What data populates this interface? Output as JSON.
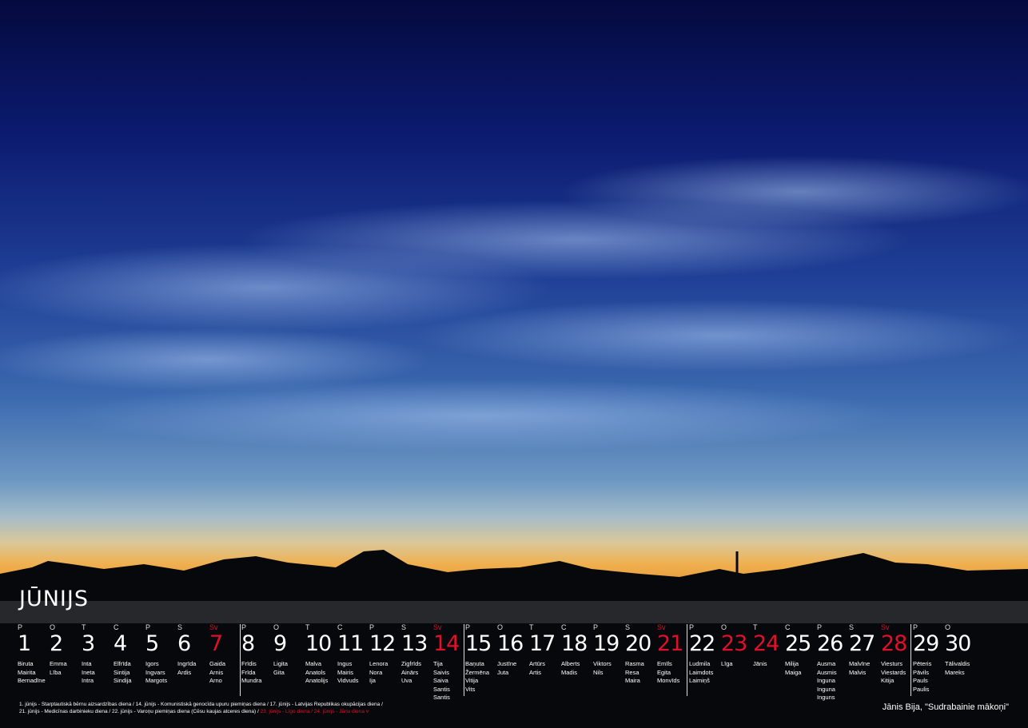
{
  "month": "JŪNIJS",
  "days": [
    {
      "wd": "P",
      "num": "1",
      "names": [
        "Biruta",
        "Mairita",
        "Bernadīne"
      ]
    },
    {
      "wd": "O",
      "num": "2",
      "names": [
        "Emma",
        "Lība"
      ]
    },
    {
      "wd": "T",
      "num": "3",
      "names": [
        "Inta",
        "Ineta",
        "Intra"
      ]
    },
    {
      "wd": "C",
      "num": "4",
      "names": [
        "Elfrīda",
        "Sintija",
        "Sindija"
      ]
    },
    {
      "wd": "P",
      "num": "5",
      "names": [
        "Igors",
        "Ingvars",
        "Margots"
      ]
    },
    {
      "wd": "S",
      "num": "6",
      "names": [
        "Ingrīda",
        "Ardis"
      ]
    },
    {
      "wd": "Sv",
      "num": "7",
      "names": [
        "Gaida",
        "Arnis",
        "Arno"
      ],
      "red": true
    },
    {
      "wd": "P",
      "num": "8",
      "names": [
        "Frīdis",
        "Frīda",
        "Mundra"
      ]
    },
    {
      "wd": "O",
      "num": "9",
      "names": [
        "Ligita",
        "Gita"
      ]
    },
    {
      "wd": "T",
      "num": "10",
      "names": [
        "Malva",
        "Anatols",
        "Anatolijs"
      ]
    },
    {
      "wd": "C",
      "num": "11",
      "names": [
        "Ingus",
        "Mairis",
        "Vidvuds"
      ]
    },
    {
      "wd": "P",
      "num": "12",
      "names": [
        "Lenora",
        "Nora",
        "Ija"
      ]
    },
    {
      "wd": "S",
      "num": "13",
      "names": [
        "Zigfrīds",
        "Ainārs",
        "Uva"
      ]
    },
    {
      "wd": "Sv",
      "num": "14",
      "names": [
        "Tija",
        "Saivis",
        "Saiva",
        "Santis",
        "Santis"
      ],
      "red": true
    },
    {
      "wd": "P",
      "num": "15",
      "names": [
        "Baņuta",
        "Žermēna",
        "Vitija",
        "Vits"
      ]
    },
    {
      "wd": "O",
      "num": "16",
      "names": [
        "Justīne",
        "Juta"
      ]
    },
    {
      "wd": "T",
      "num": "17",
      "names": [
        "Artūrs",
        "Artis"
      ]
    },
    {
      "wd": "C",
      "num": "18",
      "names": [
        "Alberts",
        "Madis"
      ]
    },
    {
      "wd": "P",
      "num": "19",
      "names": [
        "Viktors",
        "Nils"
      ]
    },
    {
      "wd": "S",
      "num": "20",
      "names": [
        "Rasma",
        "Resa",
        "Maira"
      ]
    },
    {
      "wd": "Sv",
      "num": "21",
      "names": [
        "Emīls",
        "Egita",
        "Monvīds"
      ],
      "red": true
    },
    {
      "wd": "P",
      "num": "22",
      "names": [
        "Ludmila",
        "Laimdots",
        "Laimiņš"
      ]
    },
    {
      "wd": "O",
      "num": "23",
      "names": [
        "Līga"
      ],
      "red_num": true
    },
    {
      "wd": "T",
      "num": "24",
      "names": [
        "Jānis"
      ],
      "red_num": true
    },
    {
      "wd": "C",
      "num": "25",
      "names": [
        "Milija",
        "Maiga"
      ]
    },
    {
      "wd": "P",
      "num": "26",
      "names": [
        "Ausma",
        "Ausmis",
        "Inguna",
        "Inguna",
        "Inguns"
      ]
    },
    {
      "wd": "S",
      "num": "27",
      "names": [
        "Malvīne",
        "Malvis"
      ]
    },
    {
      "wd": "Sv",
      "num": "28",
      "names": [
        "Viesturs",
        "Viestards",
        "Kitija"
      ],
      "red": true
    },
    {
      "wd": "P",
      "num": "29",
      "names": [
        "Pēteris",
        "Pāvils",
        "Pauls",
        "Paulis"
      ]
    },
    {
      "wd": "O",
      "num": "30",
      "names": [
        "Tālivaldis",
        "Mareks"
      ]
    }
  ],
  "holidays": {
    "line1": "1. jūnijs - Starptautiskā bērnu aizsardzības diena / 14. jūnijs - Komunistiskā genocīda upuru piemiņas diena / 17. jūnijs - Latvijas Republikas okupācijas diena /",
    "line2": "21. jūnijs - Medicīnas darbinieku diena / 22. jūnijs - Varoņu piemiņas diena (Cēsu kaujas atceres diena) /",
    "line2_red": " 23. jūnijs - Līgo diena / 24. jūnijs - Jāņu diena v"
  },
  "credit": "Jānis Bija, \"Sudrabainie mākoņi\"",
  "colors": {
    "holiday_red": "#e0102a",
    "text": "#ffffff"
  }
}
